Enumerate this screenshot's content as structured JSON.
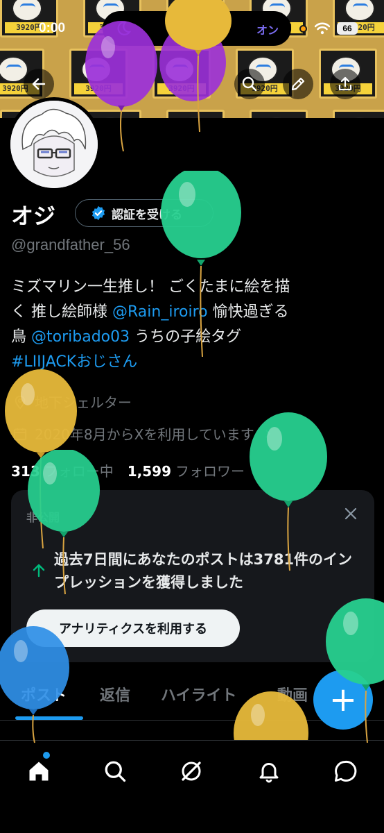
{
  "status_bar": {
    "time": "0:00",
    "island_label": "オン",
    "battery": "66"
  },
  "banner": {
    "price_label": "3920円"
  },
  "profile": {
    "name": "オジ",
    "verify_label": "認証を受ける",
    "handle": "@grandfather_56",
    "bio": {
      "line1": "ミズマリン一生推し！ ごくたまに絵を描",
      "line2_pre": "く 推し絵師様 ",
      "mention1": "@Rain_iroiro",
      "line2_post": " 愉快過ぎる",
      "line3_pre": "鳥 ",
      "mention2": "@toribado03",
      "line3_post": " うちの子絵タグ",
      "hashtag": "#LIIJACKおじさん"
    },
    "location": "地下シェルター",
    "joined": "2020年8月からXを利用しています",
    "following_count": "313",
    "following_label": "フォロー中",
    "followers_count": "1,599",
    "followers_label": "フォロワー"
  },
  "private_card": {
    "label": "非公開",
    "message": "過去7日間にあなたのポストは3781件のインプレッションを獲得しました",
    "button": "アナリティクスを利用する"
  },
  "tabs": [
    "ポスト",
    "返信",
    "ハイライト",
    "動画"
  ],
  "fab_label": "+",
  "colors": {
    "accent": "#1d9bf0",
    "background": "#000000",
    "muted": "#71767b",
    "card": "#16181c"
  },
  "icons": {
    "header": [
      "back-arrow-icon",
      "search-icon",
      "edit-icon",
      "share-icon"
    ],
    "nav": [
      "home-icon",
      "search-icon",
      "grok-icon",
      "notifications-icon",
      "messages-icon"
    ]
  }
}
